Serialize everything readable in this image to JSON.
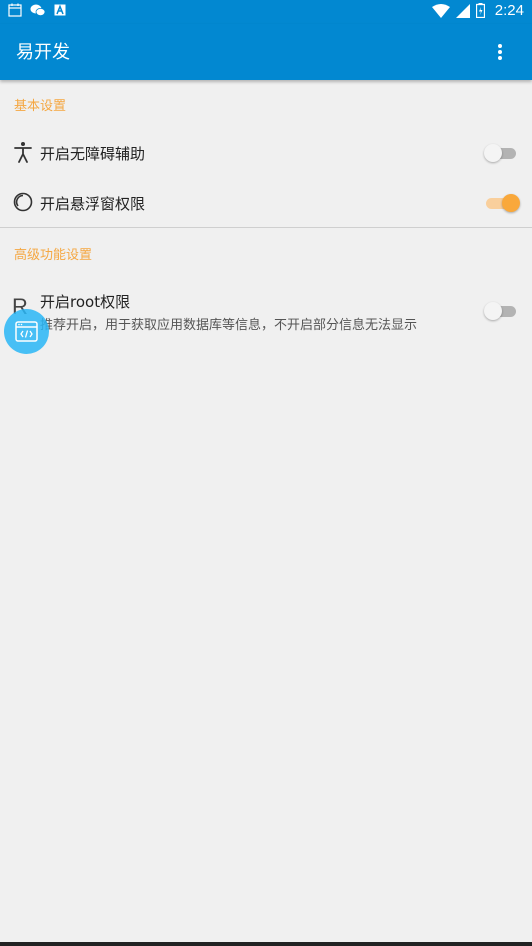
{
  "status_bar": {
    "time": "2:24",
    "icons": [
      "calendar-icon",
      "wechat-icon",
      "notification-a-icon",
      "wifi-icon",
      "signal-icon",
      "battery-icon"
    ]
  },
  "app_bar": {
    "title": "易开发",
    "menu_icon": "more-vert-icon"
  },
  "sections": [
    {
      "header": "基本设置",
      "items": [
        {
          "icon": "accessibility-icon",
          "title": "开启无障碍辅助",
          "switch_on": false
        },
        {
          "icon": "float-window-icon",
          "title": "开启悬浮窗权限",
          "switch_on": true
        }
      ]
    },
    {
      "header": "高级功能设置",
      "items": [
        {
          "icon": "root-icon",
          "icon_text": "R",
          "title": "开启root权限",
          "summary": "推荐开启，用于获取应用数据库等信息，不开启部分信息无法显示",
          "switch_on": false
        }
      ]
    }
  ],
  "floating_ball": {
    "icon": "code-window-icon"
  },
  "colors": {
    "primary": "#0288d1",
    "accent": "#f9a83b",
    "section_header": "#f5a742",
    "background": "#f0f0f0",
    "floating_ball": "#29b6f6"
  }
}
